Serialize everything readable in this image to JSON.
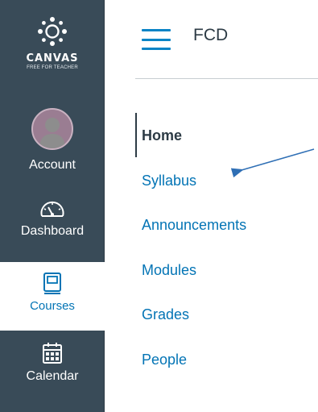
{
  "global_nav": {
    "logo": {
      "wordmark": "CANVAS",
      "tagline": "FREE FOR TEACHER"
    },
    "items": [
      {
        "label": "Account",
        "icon": "avatar"
      },
      {
        "label": "Dashboard",
        "icon": "speedometer-icon"
      },
      {
        "label": "Courses",
        "icon": "book-icon",
        "active": true
      },
      {
        "label": "Calendar",
        "icon": "calendar-icon"
      }
    ]
  },
  "header": {
    "course_title": "FCD"
  },
  "course_nav": {
    "links": [
      {
        "label": "Home",
        "active": true
      },
      {
        "label": "Syllabus"
      },
      {
        "label": "Announcements"
      },
      {
        "label": "Modules"
      },
      {
        "label": "Grades"
      },
      {
        "label": "People"
      }
    ]
  },
  "colors": {
    "nav_background": "#394b58",
    "link": "#0374b5",
    "active_text": "#2d3b45",
    "annotation_arrow": "#2f6fb5"
  }
}
